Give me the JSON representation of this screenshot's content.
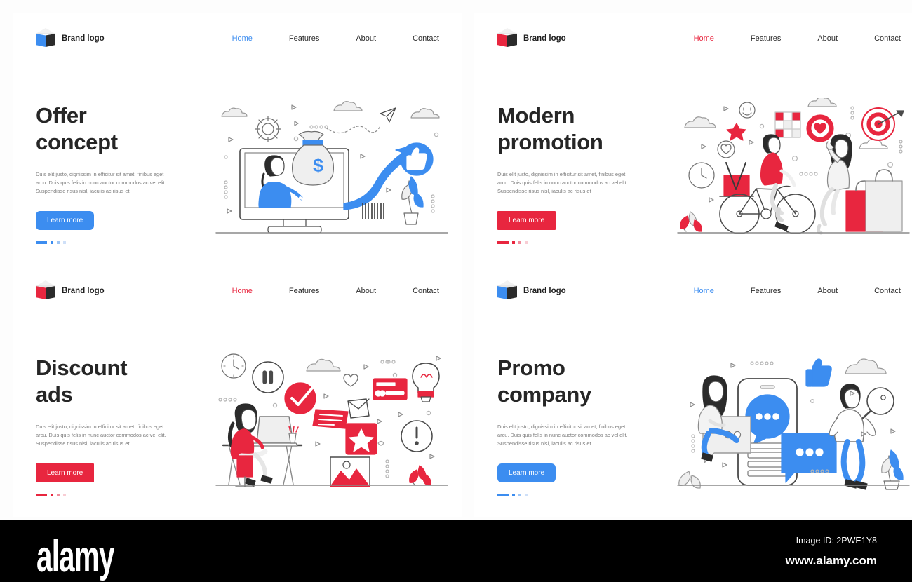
{
  "panels": [
    {
      "id": "offer-concept",
      "accent": "#3c8df0",
      "accent_name": "blue",
      "brand": {
        "label": "Brand logo",
        "icon": "cube-logo-icon"
      },
      "nav": [
        {
          "label": "Home",
          "active": true
        },
        {
          "label": "Features",
          "active": false
        },
        {
          "label": "About",
          "active": false
        },
        {
          "label": "Contact",
          "active": false
        }
      ],
      "title": "Offer concept",
      "title_line1": "Offer",
      "title_line2": "concept",
      "subtitle": "Duis elit justo, dignissim in efficitur sit amet, finibus eget arcu. Duis quis felis in nunc auctor commodos ac vel elit. Suspendisse risus nisl, iaculis ac risus et",
      "button": "Learn more",
      "pagination": {
        "active": 1,
        "total": 4
      },
      "illustration": "monitor-woman-money-bag-growth-arrow"
    },
    {
      "id": "modern-promotion",
      "accent": "#e8263f",
      "accent_name": "red",
      "brand": {
        "label": "Brand logo",
        "icon": "cube-logo-icon"
      },
      "nav": [
        {
          "label": "Home",
          "active": true
        },
        {
          "label": "Features",
          "active": false
        },
        {
          "label": "About",
          "active": false
        },
        {
          "label": "Contact",
          "active": false
        }
      ],
      "title": "Modern promotion",
      "title_line1": "Modern",
      "title_line2": "promotion",
      "subtitle": "Duis elit justo, dignissim in efficitur sit amet, finibus eget arcu. Duis quis felis in nunc auctor commodos ac vel elit. Suspendisse risus nisl, iaculis ac risus et",
      "button": "Learn more",
      "pagination": {
        "active": 1,
        "total": 4
      },
      "illustration": "cyclist-delivery-shopping-bags-target"
    },
    {
      "id": "discount-ads",
      "accent": "#e8263f",
      "accent_name": "red",
      "brand": {
        "label": "Brand logo",
        "icon": "cube-logo-icon"
      },
      "nav": [
        {
          "label": "Home",
          "active": true
        },
        {
          "label": "Features",
          "active": false
        },
        {
          "label": "About",
          "active": false
        },
        {
          "label": "Contact",
          "active": false
        }
      ],
      "title": "Discount ads",
      "title_line1": "Discount",
      "title_line2": "ads",
      "subtitle": "Duis elit justo, dignissim in efficitur sit amet, finibus eget arcu. Duis quis felis in nunc auctor commodos ac vel elit. Suspendisse risus nisl, iaculis ac risus et",
      "button": "Learn more",
      "pagination": {
        "active": 1,
        "total": 4
      },
      "illustration": "woman-desk-laptop-checkmark-card-bulb"
    },
    {
      "id": "promo-company",
      "accent": "#3c8df0",
      "accent_name": "blue",
      "brand": {
        "label": "Brand logo",
        "icon": "cube-logo-icon"
      },
      "nav": [
        {
          "label": "Home",
          "active": true
        },
        {
          "label": "Features",
          "active": false
        },
        {
          "label": "About",
          "active": false
        },
        {
          "label": "Contact",
          "active": false
        }
      ],
      "title": "Promo company",
      "title_line1": "Promo",
      "title_line2": "company",
      "subtitle": "Duis elit justo, dignissim in efficitur sit amet, finibus eget arcu. Duis quis felis in nunc auctor commodos ac vel elit. Suspendisse risus nisl, iaculis ac risus et",
      "button": "Learn more",
      "pagination": {
        "active": 1,
        "total": 4
      },
      "illustration": "smartphone-chat-bubbles-two-people"
    }
  ],
  "watermark": {
    "text": "alamy"
  },
  "footer": {
    "logo": "alamy",
    "image_id": "Image ID: 2PWE1Y8",
    "url": "www.alamy.com"
  }
}
